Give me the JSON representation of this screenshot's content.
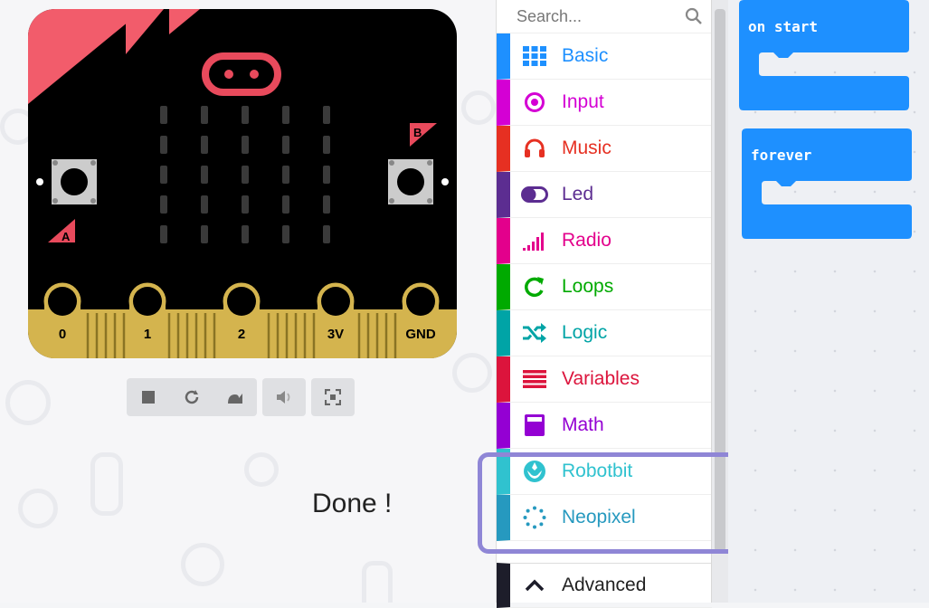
{
  "simulator": {
    "pins": [
      "0",
      "1",
      "2",
      "3V",
      "GND"
    ],
    "buttons": {
      "a": "A",
      "b": "B"
    },
    "toolbar": [
      "stop-icon",
      "restart-icon",
      "slow-motion-icon",
      "mute-icon",
      "fullscreen-icon"
    ],
    "status": "Done !"
  },
  "toolbox": {
    "search_placeholder": "Search...",
    "categories": [
      {
        "label": "Basic",
        "color": "#1e90ff"
      },
      {
        "label": "Input",
        "color": "#d400d4"
      },
      {
        "label": "Music",
        "color": "#e63022"
      },
      {
        "label": "Led",
        "color": "#5c2d91"
      },
      {
        "label": "Radio",
        "color": "#e3008c"
      },
      {
        "label": "Loops",
        "color": "#00aa00"
      },
      {
        "label": "Logic",
        "color": "#00a4a6"
      },
      {
        "label": "Variables",
        "color": "#dc143c"
      },
      {
        "label": "Math",
        "color": "#9400d3"
      },
      {
        "label": "Robotbit",
        "color": "#30c2cf"
      },
      {
        "label": "Neopixel",
        "color": "#2699bf"
      },
      {
        "label": "Advanced",
        "color": "#1d1d2a"
      }
    ]
  },
  "workspace": {
    "blocks": [
      {
        "label": "on start",
        "color": "#1e90ff"
      },
      {
        "label": "forever",
        "color": "#1e90ff"
      }
    ]
  }
}
